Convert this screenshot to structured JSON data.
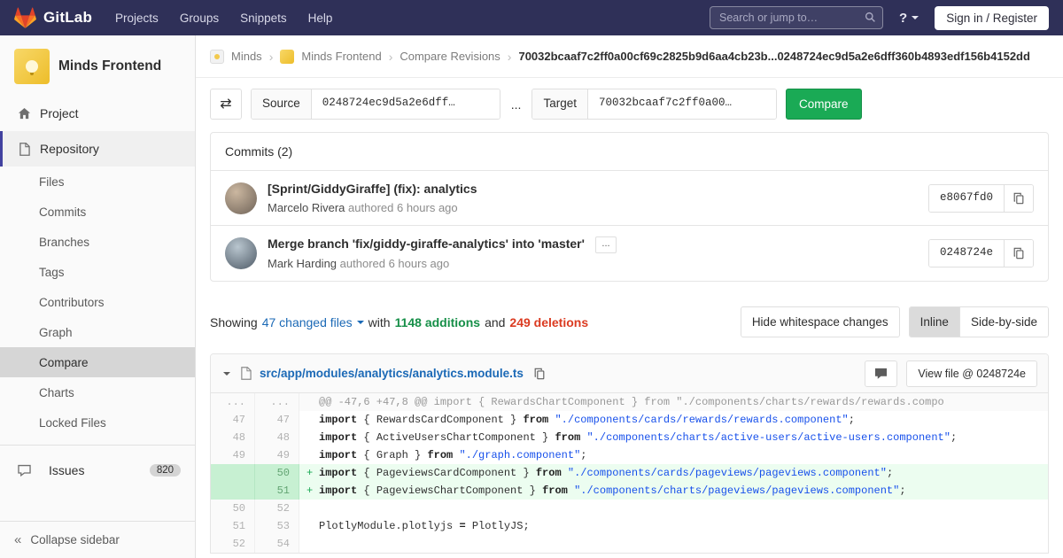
{
  "navbar": {
    "brand": "GitLab",
    "links": [
      "Projects",
      "Groups",
      "Snippets",
      "Help"
    ],
    "search_placeholder": "Search or jump to…",
    "signin_label": "Sign in / Register"
  },
  "icons": {
    "help": "?",
    "swap": "⇄",
    "ellipsis": "...",
    "collapse": "«",
    "crumb_sep": "›"
  },
  "sidebar": {
    "project_name": "Minds Frontend",
    "items": {
      "project": "Project",
      "repository": "Repository",
      "repository_sub": [
        "Files",
        "Commits",
        "Branches",
        "Tags",
        "Contributors",
        "Graph",
        "Compare",
        "Charts",
        "Locked Files"
      ],
      "issues": "Issues",
      "issues_count": "820",
      "collapse": "Collapse sidebar"
    }
  },
  "breadcrumbs": {
    "items": [
      "Minds",
      "Minds Frontend",
      "Compare Revisions"
    ],
    "current": "70032bcaaf7c2ff0a00cf69c2825b9d6aa4cb23b...0248724ec9d5a2e6dff360b4893edf156b4152dd"
  },
  "compare_form": {
    "source_label": "Source",
    "source_value": "0248724ec9d5a2e6dff…",
    "separator": "...",
    "target_label": "Target",
    "target_value": "70032bcaaf7c2ff0a00…",
    "compare_button": "Compare"
  },
  "commits": {
    "header": "Commits (2)",
    "items": [
      {
        "title": "[Sprint/GiddyGiraffe] (fix): analytics",
        "author": "Marcelo Rivera",
        "authored": "authored 6 hours ago",
        "sha": "e8067fd0"
      },
      {
        "title": "Merge branch 'fix/giddy-giraffe-analytics' into 'master'",
        "author": "Mark Harding",
        "authored": "authored 6 hours ago",
        "sha": "0248724e"
      }
    ]
  },
  "stats": {
    "showing": "Showing",
    "files_link": "47 changed files",
    "with_word": "with",
    "additions": "1148 additions",
    "and_word": "and",
    "deletions": "249 deletions",
    "hide_whitespace": "Hide whitespace changes",
    "inline": "Inline",
    "side_by_side": "Side-by-side"
  },
  "diff": {
    "file_path": "src/app/modules/analytics/analytics.module.ts",
    "view_file": "View file @ 0248724e",
    "lines": [
      {
        "old": "...",
        "new": "...",
        "t": "hunk",
        "seg": [
          [
            "h",
            "@@ -47,6 +47,8 @@ import { RewardsChartComponent } from \"./components/charts/rewards/rewards.compo"
          ]
        ]
      },
      {
        "old": "47",
        "new": "47",
        "t": "ctx",
        "seg": [
          [
            "k",
            "import"
          ],
          [
            "p",
            " { RewardsCardComponent } "
          ],
          [
            "k",
            "from"
          ],
          [
            "p",
            " "
          ],
          [
            "s",
            "\"./components/cards/rewards/rewards.component\""
          ],
          [
            "p",
            ";"
          ]
        ]
      },
      {
        "old": "48",
        "new": "48",
        "t": "ctx",
        "seg": [
          [
            "k",
            "import"
          ],
          [
            "p",
            " { ActiveUsersChartComponent } "
          ],
          [
            "k",
            "from"
          ],
          [
            "p",
            " "
          ],
          [
            "s",
            "\"./components/charts/active-users/active-users.component\""
          ],
          [
            "p",
            ";"
          ]
        ]
      },
      {
        "old": "49",
        "new": "49",
        "t": "ctx",
        "seg": [
          [
            "k",
            "import"
          ],
          [
            "p",
            " { Graph } "
          ],
          [
            "k",
            "from"
          ],
          [
            "p",
            " "
          ],
          [
            "s",
            "\"./graph.component\""
          ],
          [
            "p",
            ";"
          ]
        ]
      },
      {
        "old": "",
        "new": "50",
        "t": "add",
        "seg": [
          [
            "k",
            "import"
          ],
          [
            "p",
            " { PageviewsCardComponent } "
          ],
          [
            "k",
            "from"
          ],
          [
            "p",
            " "
          ],
          [
            "s",
            "\"./components/cards/pageviews/pageviews.component\""
          ],
          [
            "p",
            ";"
          ]
        ]
      },
      {
        "old": "",
        "new": "51",
        "t": "add",
        "seg": [
          [
            "k",
            "import"
          ],
          [
            "p",
            " { PageviewsChartComponent } "
          ],
          [
            "k",
            "from"
          ],
          [
            "p",
            " "
          ],
          [
            "s",
            "\"./components/charts/pageviews/pageviews.component\""
          ],
          [
            "p",
            ";"
          ]
        ]
      },
      {
        "old": "50",
        "new": "52",
        "t": "ctx",
        "seg": []
      },
      {
        "old": "51",
        "new": "53",
        "t": "ctx",
        "seg": [
          [
            "p",
            "PlotlyModule.plotlyjs "
          ],
          [
            "o",
            "="
          ],
          [
            "p",
            " PlotlyJS;"
          ]
        ]
      },
      {
        "old": "52",
        "new": "54",
        "t": "ctx",
        "seg": []
      }
    ]
  },
  "colors": {
    "navbar_bg": "#2f3058",
    "accent_green": "#1aaa55",
    "deletion_red": "#db3b21",
    "link_blue": "#1b69b6",
    "addition_bg": "#ecfdf0",
    "sidebar_active_border": "#41419f"
  }
}
